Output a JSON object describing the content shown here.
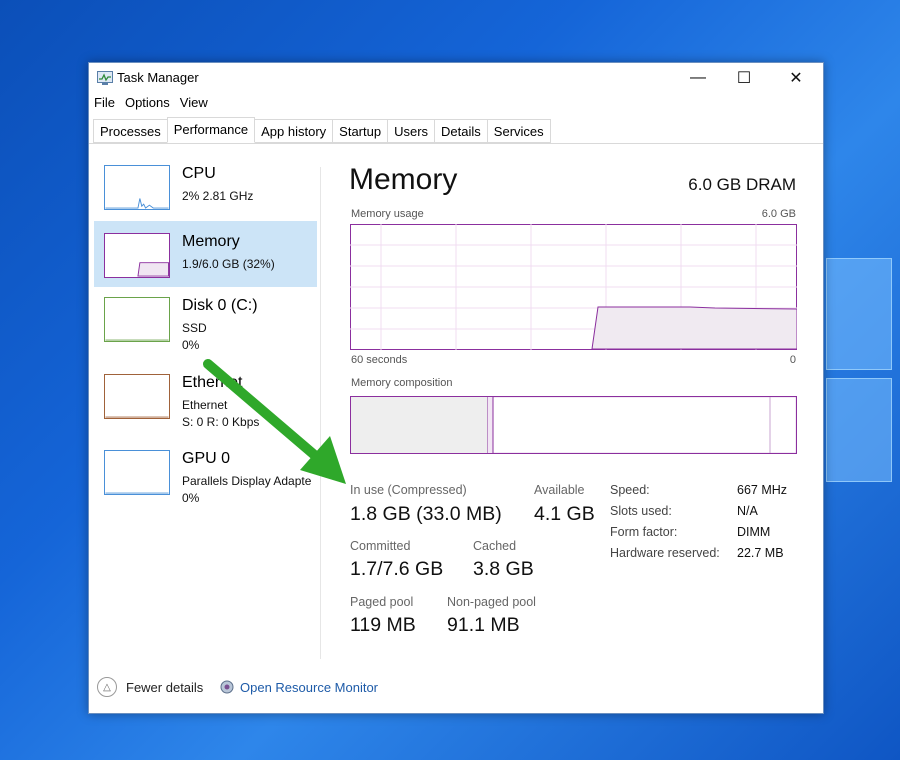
{
  "window": {
    "title": "Task Manager",
    "controls": {
      "minimize": "—",
      "maximize": "☐",
      "close": "✕"
    }
  },
  "menu": [
    "File",
    "Options",
    "View"
  ],
  "tabs": [
    {
      "label": "Processes",
      "active": false
    },
    {
      "label": "Performance",
      "active": true
    },
    {
      "label": "App history",
      "active": false
    },
    {
      "label": "Startup",
      "active": false
    },
    {
      "label": "Users",
      "active": false
    },
    {
      "label": "Details",
      "active": false
    },
    {
      "label": "Services",
      "active": false
    }
  ],
  "sidebar": [
    {
      "name": "CPU",
      "line1": "2%  2.81 GHz",
      "line2": "",
      "color": "#4a90d8",
      "selected": false
    },
    {
      "name": "Memory",
      "line1": "1.9/6.0 GB (32%)",
      "line2": "",
      "color": "#8b2f9e",
      "selected": true
    },
    {
      "name": "Disk 0 (C:)",
      "line1": "SSD",
      "line2": "0%",
      "color": "#6aa34a",
      "selected": false
    },
    {
      "name": "Ethernet",
      "line1": "Ethernet",
      "line2": "S: 0  R: 0 Kbps",
      "color": "#a0623a",
      "selected": false
    },
    {
      "name": "GPU 0",
      "line1": "Parallels Display Adapte",
      "line2": "0%",
      "color": "#4a90d8",
      "selected": false
    }
  ],
  "memory": {
    "title": "Memory",
    "capacity": "6.0 GB DRAM",
    "usage_label": "Memory usage",
    "usage_max": "6.0 GB",
    "time_left": "60 seconds",
    "time_right": "0",
    "composition_label": "Memory composition",
    "in_use_label": "In use (Compressed)",
    "in_use_value": "1.8 GB (33.0 MB)",
    "available_label": "Available",
    "available_value": "4.1 GB",
    "committed_label": "Committed",
    "committed_value": "1.7/7.6 GB",
    "cached_label": "Cached",
    "cached_value": "3.8 GB",
    "paged_label": "Paged pool",
    "paged_value": "119 MB",
    "nonpaged_label": "Non-paged pool",
    "nonpaged_value": "91.1 MB",
    "specs": [
      {
        "label": "Speed:",
        "value": "667 MHz"
      },
      {
        "label": "Slots used:",
        "value": "N/A"
      },
      {
        "label": "Form factor:",
        "value": "DIMM"
      },
      {
        "label": "Hardware reserved:",
        "value": "22.7 MB"
      }
    ],
    "usage_fraction": 0.32,
    "accent_color": "#8b2f9e"
  },
  "footer": {
    "fewer_details": "Fewer details",
    "resource_monitor": "Open Resource Monitor"
  },
  "annotation": {
    "arrow_color": "#2fa82a"
  }
}
